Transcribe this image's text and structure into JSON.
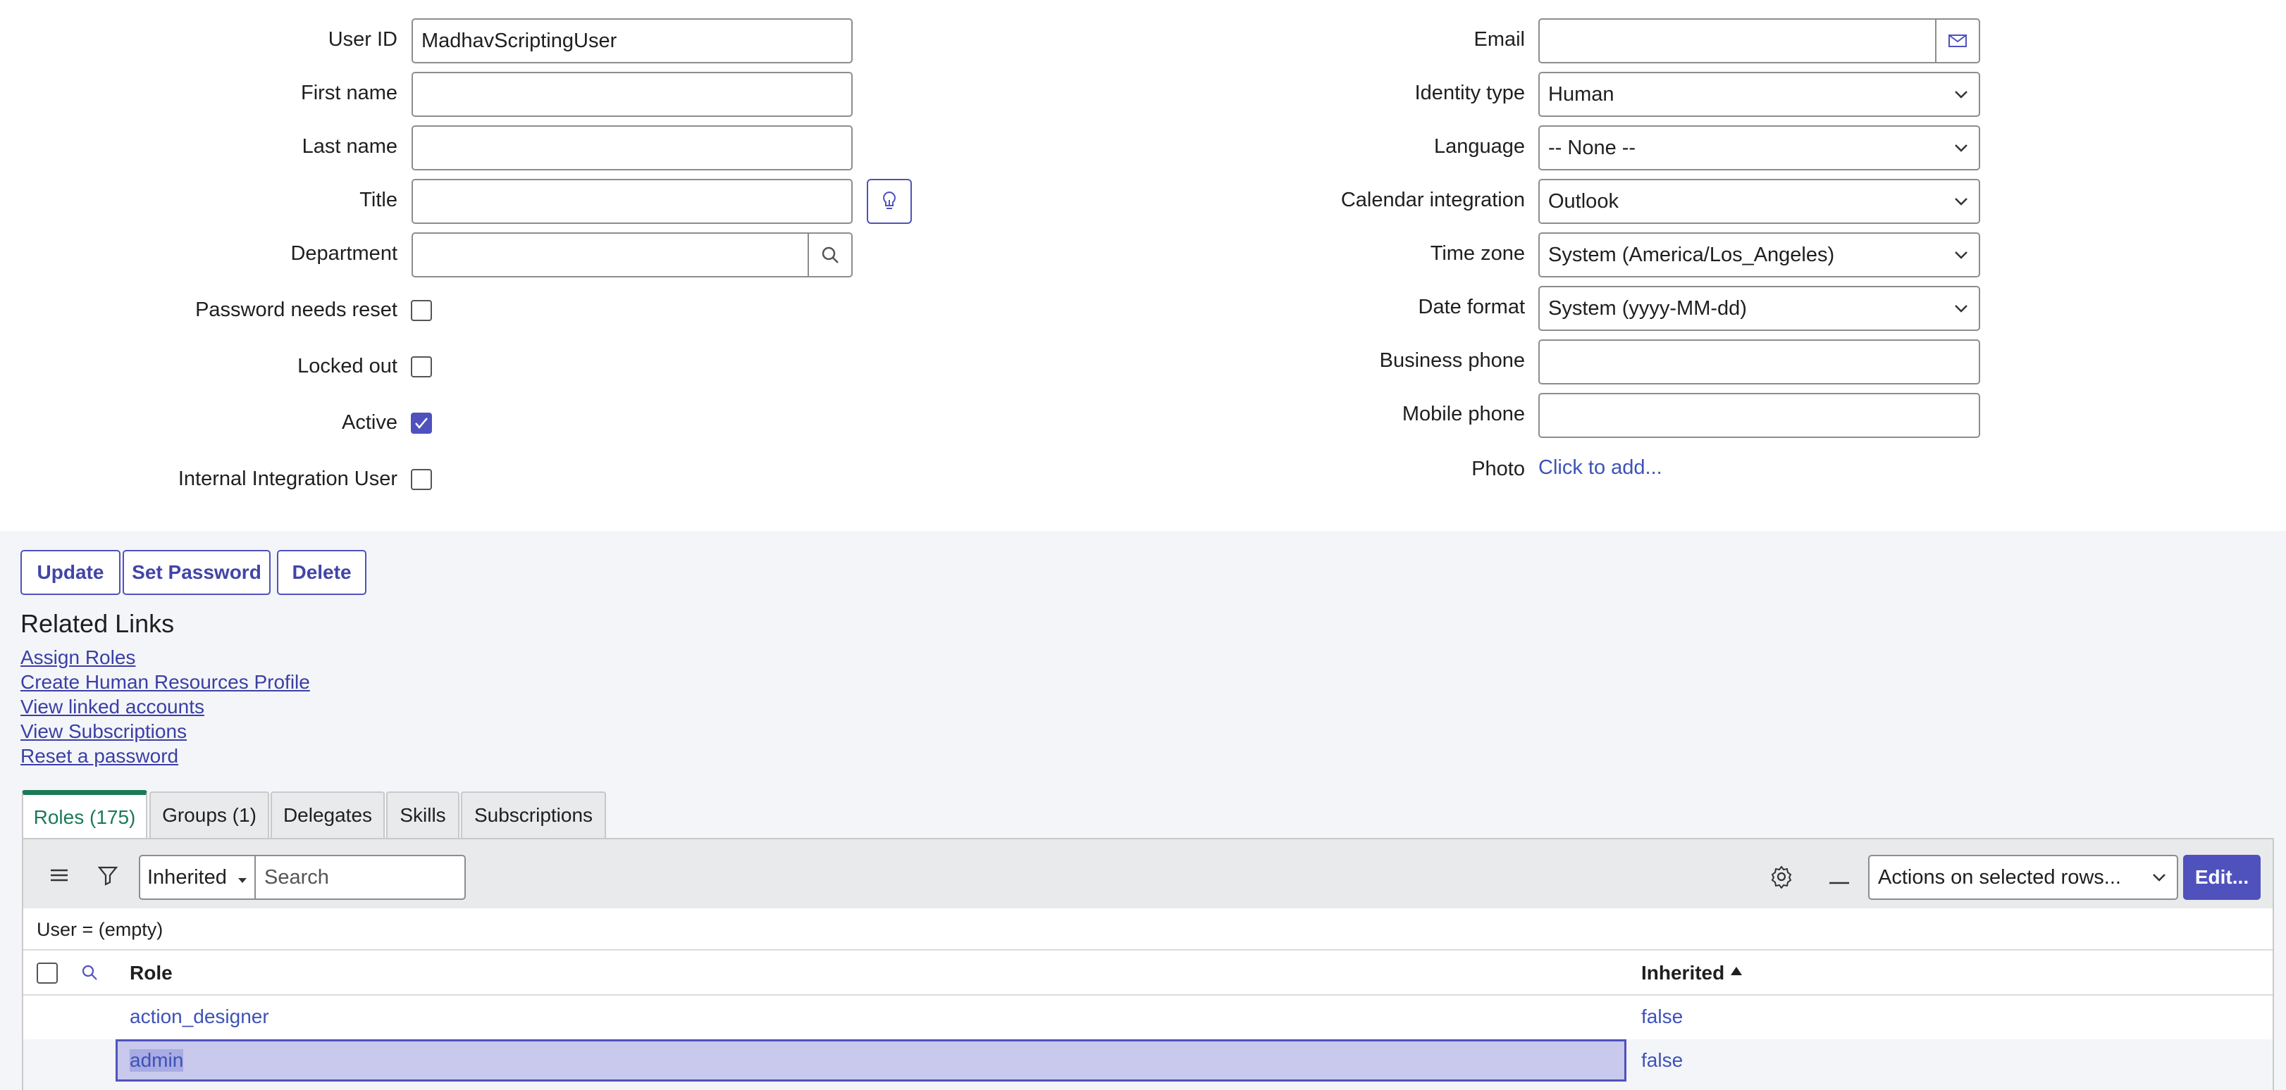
{
  "form": {
    "left": {
      "user_id_label": "User ID",
      "user_id_value": "MadhavScriptingUser",
      "first_name_label": "First name",
      "first_name_value": "",
      "last_name_label": "Last name",
      "last_name_value": "",
      "title_label": "Title",
      "title_value": "",
      "department_label": "Department",
      "department_value": "",
      "password_reset_label": "Password needs reset",
      "password_reset_checked": false,
      "locked_out_label": "Locked out",
      "locked_out_checked": false,
      "active_label": "Active",
      "active_checked": true,
      "internal_integration_label": "Internal Integration User",
      "internal_integration_checked": false
    },
    "right": {
      "email_label": "Email",
      "email_value": "",
      "identity_type_label": "Identity type",
      "identity_type_value": "Human",
      "language_label": "Language",
      "language_value": "-- None --",
      "calendar_label": "Calendar integration",
      "calendar_value": "Outlook",
      "timezone_label": "Time zone",
      "timezone_value": "System (America/Los_Angeles)",
      "date_format_label": "Date format",
      "date_format_value": "System (yyyy-MM-dd)",
      "business_phone_label": "Business phone",
      "business_phone_value": "",
      "mobile_phone_label": "Mobile phone",
      "mobile_phone_value": "",
      "photo_label": "Photo",
      "photo_link": "Click to add..."
    }
  },
  "actions": {
    "update": "Update",
    "set_password": "Set Password",
    "delete": "Delete"
  },
  "related_links": {
    "title": "Related Links",
    "items": [
      "Assign Roles",
      "Create Human Resources Profile",
      "View linked accounts",
      "View Subscriptions",
      "Reset a password"
    ]
  },
  "tabs": [
    {
      "label": "Roles (175)",
      "active": true
    },
    {
      "label": "Groups (1)",
      "active": false
    },
    {
      "label": "Delegates",
      "active": false
    },
    {
      "label": "Skills",
      "active": false
    },
    {
      "label": "Subscriptions",
      "active": false
    }
  ],
  "list": {
    "search_field": "Inherited",
    "search_placeholder": "Search",
    "actions_select": "Actions on selected rows...",
    "edit_button": "Edit...",
    "breadcrumb": "User = (empty)",
    "columns": [
      "Role",
      "Inherited"
    ],
    "rows": [
      {
        "role": "action_designer",
        "inherited": "false"
      },
      {
        "role": "admin",
        "inherited": "false"
      }
    ]
  },
  "colors": {
    "accent": "#4f52bd",
    "active_tab": "#1a7a55",
    "link": "#3a3fa6",
    "section_bg": "#f4f5f8"
  }
}
